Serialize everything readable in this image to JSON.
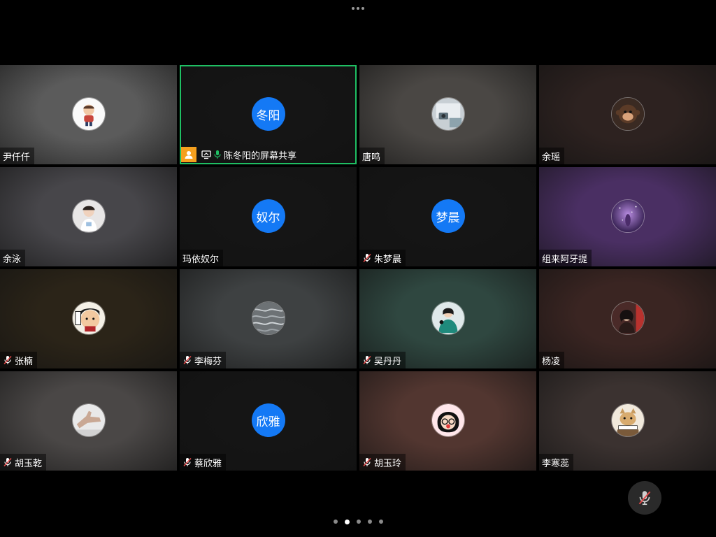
{
  "top_bar": {
    "more_icon": "more-dots-icon"
  },
  "participants": [
    {
      "name": "尹仟仟",
      "avatar": "photo-cartoon-boy",
      "muted": false,
      "bg": "#5b5b5b"
    },
    {
      "name": "陈冬阳的屏幕共享",
      "avatar_text": "冬阳",
      "muted": false,
      "sharing": true,
      "host": true,
      "bg": "#151515"
    },
    {
      "name": "唐鸣",
      "avatar": "photo-camera",
      "muted": false,
      "bg": "#4a4744"
    },
    {
      "name": "余瑶",
      "avatar": "photo-monkey",
      "muted": false,
      "bg": "#2d2220"
    },
    {
      "name": "余泳",
      "avatar": "photo-child",
      "muted": false,
      "bg": "#47464a"
    },
    {
      "name": "玛依奴尔",
      "avatar_text": "奴尔",
      "muted": false,
      "bg": "#151515"
    },
    {
      "name": "朱梦晨",
      "avatar_text": "梦晨",
      "muted": true,
      "bg": "#151515"
    },
    {
      "name": "组来阿牙提",
      "avatar": "photo-purple-night",
      "muted": false,
      "bg": "#4a2f63"
    },
    {
      "name": "张楠",
      "avatar": "photo-cartoon-face",
      "muted": true,
      "bg": "#2b2418"
    },
    {
      "name": "李梅芬",
      "avatar": "photo-water",
      "muted": true,
      "bg": "#3e4142"
    },
    {
      "name": "吴丹丹",
      "avatar": "photo-girl-green",
      "muted": true,
      "bg": "#2f4740"
    },
    {
      "name": "杨凌",
      "avatar": "photo-woman-red",
      "muted": false,
      "bg": "#3a2522"
    },
    {
      "name": "胡玉乾",
      "avatar": "photo-hand",
      "muted": true,
      "bg": "#4a4746"
    },
    {
      "name": "蔡欣雅",
      "avatar_text": "欣雅",
      "muted": true,
      "bg": "#151515"
    },
    {
      "name": "胡玉玲",
      "avatar": "photo-cartoon-girl",
      "muted": true,
      "bg": "#523630"
    },
    {
      "name": "李寒蕊",
      "avatar": "photo-cat",
      "muted": false,
      "bg": "#3b3230"
    }
  ],
  "controls": {
    "mic_state": "muted",
    "mic_icon": "mic-off-icon"
  },
  "pagination": {
    "total": 5,
    "current": 2
  },
  "colors": {
    "accent_blue": "#1479f5",
    "active_border": "#1fbf63",
    "host_badge": "#f5a01e",
    "mic_green": "#1fbf63",
    "muted_red": "#e24a4a"
  }
}
